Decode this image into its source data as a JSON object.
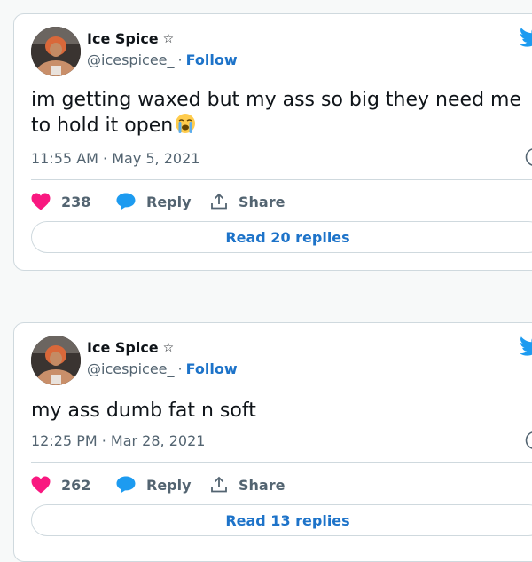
{
  "tweets": [
    {
      "name": "Ice Spice",
      "badge_icon": "star-icon",
      "handle": "@icespicee_",
      "separator": "·",
      "follow_label": "Follow",
      "text": "im getting waxed but my ass so big they need me to hold it open",
      "emoji": "loudly-crying-face",
      "timestamp": "11:55 AM · May 5, 2021",
      "likes": "238",
      "reply_label": "Reply",
      "share_label": "Share",
      "read_replies_label": "Read 20 replies"
    },
    {
      "name": "Ice Spice",
      "badge_icon": "star-icon",
      "handle": "@icespicee_",
      "separator": "·",
      "follow_label": "Follow",
      "text": "my ass dumb fat n soft",
      "timestamp": "12:25 PM · Mar 28, 2021",
      "likes": "262",
      "reply_label": "Reply",
      "share_label": "Share",
      "read_replies_label": "Read 13 replies"
    }
  ],
  "colors": {
    "link_blue": "#1d73c9",
    "twitter_blue": "#1d9bf0",
    "heart_pink": "#f91880",
    "muted_text": "#536471",
    "border": "#cfd9de"
  }
}
